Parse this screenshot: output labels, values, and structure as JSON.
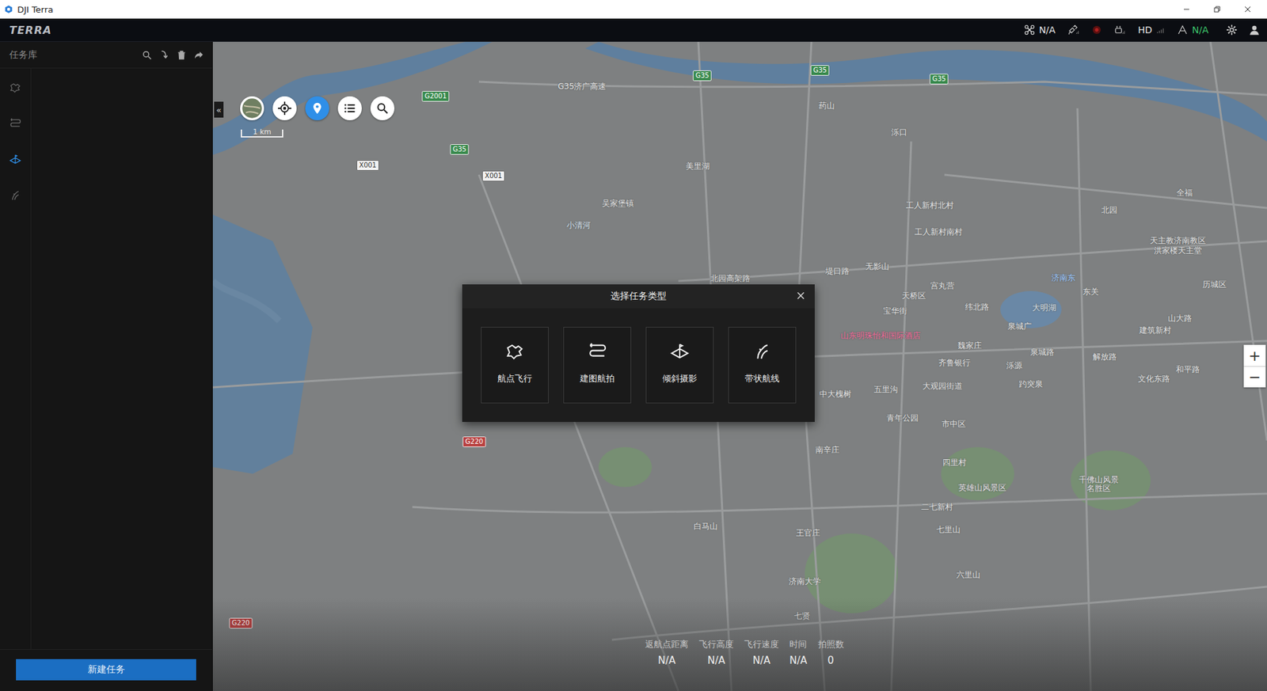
{
  "window": {
    "title": "DJI Terra"
  },
  "topbar": {
    "logo": "TERRA",
    "drone_status": "N/A",
    "video": "HD",
    "battery_status": "N/A"
  },
  "sidebar": {
    "title": "任务库",
    "nav": [
      {
        "kind": "waypoint",
        "selected": false
      },
      {
        "kind": "mapping",
        "selected": false
      },
      {
        "kind": "oblique",
        "selected": true
      },
      {
        "kind": "corridor",
        "selected": false
      }
    ],
    "new_button": "新建任务"
  },
  "map": {
    "collapse": "«",
    "scale": "1 km",
    "zoom": {
      "in": "+",
      "out": "−"
    },
    "labels": [
      {
        "text": "G35济广高速",
        "color": "#e4e4e4"
      },
      {
        "text": "药山",
        "color": "#e4e4e4"
      },
      {
        "text": "泺口",
        "color": "#e4e4e4"
      },
      {
        "text": "美里湖",
        "color": "#e4e4e4"
      },
      {
        "text": "吴家堡镇",
        "color": "#e4e4e4"
      },
      {
        "text": "小清河",
        "color": "#d8e4f0"
      },
      {
        "text": "工人新村北村",
        "color": "#e4e4e4"
      },
      {
        "text": "工人新村南村",
        "color": "#e4e4e4"
      },
      {
        "text": "北园",
        "color": "#e4e4e4"
      },
      {
        "text": "天主教济南教区",
        "color": "#e4e4e4"
      },
      {
        "text": "洪家楼天主堂",
        "color": "#e4e4e4"
      },
      {
        "text": "全福",
        "color": "#e4e4e4"
      },
      {
        "text": "济南东",
        "color": "#9cc8ff"
      },
      {
        "text": "无影山",
        "color": "#e4e4e4"
      },
      {
        "text": "堤口路",
        "color": "#e4e4e4"
      },
      {
        "text": "北园高架路",
        "color": "#e4e4e4"
      },
      {
        "text": "天桥区",
        "color": "#e4e4e4"
      },
      {
        "text": "宫丸营",
        "color": "#e4e4e4"
      },
      {
        "text": "宝华街",
        "color": "#e4e4e4"
      },
      {
        "text": "纬北路",
        "color": "#e4e4e4"
      },
      {
        "text": "大明湖",
        "color": "#d8e4f0"
      },
      {
        "text": "山东明珠怡和国际酒店",
        "color": "#f06a9a"
      },
      {
        "text": "齐鲁银行",
        "color": "#e4e4e4"
      },
      {
        "text": "魏家庄",
        "color": "#e4e4e4"
      },
      {
        "text": "泉城路",
        "color": "#e4e4e4"
      },
      {
        "text": "解放路",
        "color": "#e4e4e4"
      },
      {
        "text": "中大槐树",
        "color": "#e4e4e4"
      },
      {
        "text": "五里沟",
        "color": "#e4e4e4"
      },
      {
        "text": "大观园街道",
        "color": "#e4e4e4"
      },
      {
        "text": "市中区",
        "color": "#e4e4e4"
      },
      {
        "text": "青年公园",
        "color": "#e4e4e4"
      },
      {
        "text": "南辛庄",
        "color": "#e4e4e4"
      },
      {
        "text": "四里村",
        "color": "#e4e4e4"
      },
      {
        "text": "英雄山风景区",
        "color": "#e4e4e4"
      },
      {
        "text": "千佛山风景",
        "color": "#e4e4e4"
      },
      {
        "text": "名胜区",
        "color": "#e4e4e4"
      },
      {
        "text": "二七新村",
        "color": "#e4e4e4"
      },
      {
        "text": "七里山",
        "color": "#e4e4e4"
      },
      {
        "text": "白马山",
        "color": "#e4e4e4"
      },
      {
        "text": "王官庄",
        "color": "#e4e4e4"
      },
      {
        "text": "济南大学",
        "color": "#e4e4e4"
      },
      {
        "text": "六里山",
        "color": "#e4e4e4"
      },
      {
        "text": "七贤",
        "color": "#e4e4e4"
      },
      {
        "text": "文化东路",
        "color": "#e4e4e4"
      },
      {
        "text": "和平路",
        "color": "#e4e4e4"
      },
      {
        "text": "历城区",
        "color": "#e4e4e4"
      },
      {
        "text": "山大路",
        "color": "#e4e4e4"
      },
      {
        "text": "建筑新村",
        "color": "#e4e4e4"
      },
      {
        "text": "东关",
        "color": "#e4e4e4"
      },
      {
        "text": "泺源",
        "color": "#e4e4e4"
      },
      {
        "text": "趵突泉",
        "color": "#e4e4e4"
      },
      {
        "text": "泉城广",
        "color": "#e4e4e4"
      }
    ],
    "road_badges": [
      {
        "text": "G35",
        "color": "#3a8a4e"
      },
      {
        "text": "G35",
        "color": "#3a8a4e"
      },
      {
        "text": "G35",
        "color": "#3a8a4e"
      },
      {
        "text": "G2001",
        "color": "#3a8a4e"
      },
      {
        "text": "G35",
        "color": "#3a8a4e"
      },
      {
        "text": "X001",
        "color": "#f2f2f2"
      },
      {
        "text": "X001",
        "color": "#f2f2f2"
      },
      {
        "text": "G220",
        "color": "#b84040"
      },
      {
        "text": "G220",
        "color": "#b84040"
      }
    ]
  },
  "dialog": {
    "title": "选择任务类型",
    "cards": [
      {
        "label": "航点飞行",
        "kind": "waypoint"
      },
      {
        "label": "建图航拍",
        "kind": "mapping"
      },
      {
        "label": "倾斜摄影",
        "kind": "oblique"
      },
      {
        "label": "带状航线",
        "kind": "corridor"
      }
    ]
  },
  "stats": [
    {
      "label": "返航点距离",
      "value": "N/A"
    },
    {
      "label": "飞行高度",
      "value": "N/A"
    },
    {
      "label": "飞行速度",
      "value": "N/A"
    },
    {
      "label": "时间",
      "value": "N/A"
    },
    {
      "label": "拍照数",
      "value": "0"
    }
  ]
}
